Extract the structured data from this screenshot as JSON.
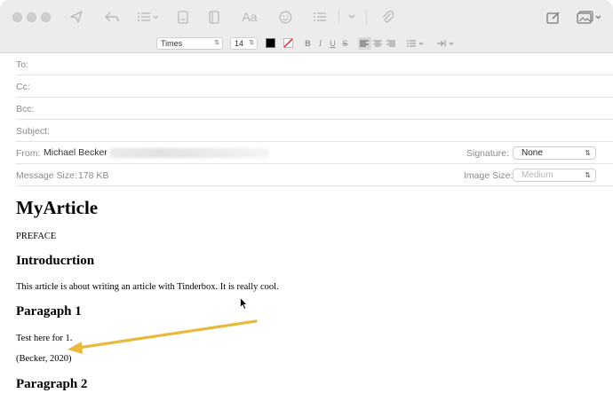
{
  "toolbar": {
    "icons": [
      "send-icon",
      "reply-icon",
      "list-icon",
      "attachment-browser-icon",
      "photo-browser-icon",
      "fonts-icon",
      "emoji-icon",
      "bullets-icon",
      "dropdown-icon",
      "paperclip-icon",
      "markup-icon",
      "photo-icon"
    ]
  },
  "format_bar": {
    "font_family": "Times",
    "font_size": "14",
    "text_color": "#000000",
    "bold_label": "B",
    "italic_label": "I",
    "underline_label": "U",
    "strike_label": "S"
  },
  "header": {
    "to_label": "To:",
    "cc_label": "Cc:",
    "bcc_label": "Bcc:",
    "subject_label": "Subject:",
    "from_label": "From:",
    "from_value": "Michael Becker",
    "signature_label": "Signature:",
    "signature_value": "None",
    "message_size_label": "Message Size:",
    "message_size_value": "178 KB",
    "image_size_label": "Image Size:",
    "image_size_value": "Medium"
  },
  "body": {
    "title": "MyArticle",
    "preface": "PREFACE",
    "intro_heading": "Introducrtion",
    "intro_text": "This article is about writing an article with Tinderbox. It is really cool.",
    "para1_heading": "Paragaph 1",
    "para1_text": "Test here for 1.",
    "citation": "(Becker, 2020)",
    "para2_heading": "Paragraph 2"
  },
  "colors": {
    "toolbar_bg": "#ececec",
    "arrow": "#e8b93a"
  }
}
